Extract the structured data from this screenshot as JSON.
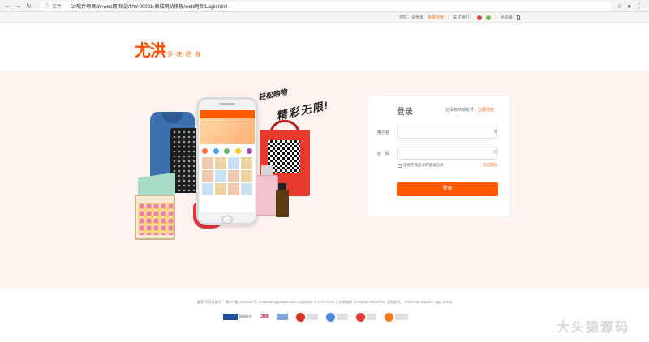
{
  "browser": {
    "info_label": "文件",
    "url": "D:/软件项目/W-web网页设计/W-00001-商城网站模板/web网页/Login.html"
  },
  "topbar": {
    "greeting": "您好，请登录",
    "register": "免费注册",
    "follow": "关注我们：",
    "mobile": "手机版"
  },
  "logo": {
    "main": "尤洪",
    "sub": "多·快·好·省"
  },
  "banner": {
    "slogan_line1": "轻松购物",
    "slogan_line2": "精彩无限!"
  },
  "login": {
    "title": "登录",
    "tip": "还没有商城账号，",
    "register_link": "立即注册",
    "username_label": "用户名",
    "password_label": "密　码",
    "username_value": "",
    "password_value": "",
    "remember": "请保存我这次的登录信息",
    "forgot": "忘记密码",
    "submit": "登录"
  },
  "footer": {
    "copyright": "备案/许可证编号：蜀ICP备12009302号-1-www.dingguagua.com Copyright © 2015-2018 尤洪商城网 All Rights Reserved. 复制必究 , Technical Support: Dgg Group",
    "badges": [
      {
        "label": "网银在线",
        "color": "#1e4fa3"
      },
      {
        "label": "JDB",
        "color": "#c8102e"
      },
      {
        "label": "",
        "color": "#7fa6d8"
      },
      {
        "label": "",
        "color": "#d93025"
      },
      {
        "label": "",
        "color": "#4a89dc"
      },
      {
        "label": "",
        "color": "#e53935"
      },
      {
        "label": "",
        "color": "#ff7a1a"
      }
    ]
  },
  "watermark": "大头猿源码",
  "colors": {
    "accent": "#ff5a00",
    "banner_bg": "#fff3ef"
  }
}
